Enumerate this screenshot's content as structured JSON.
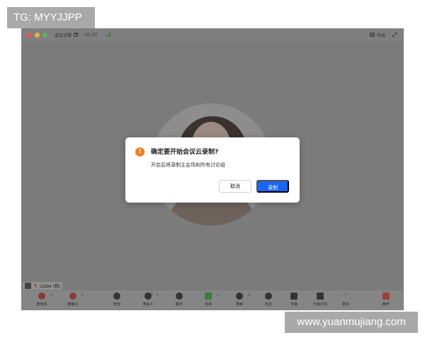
{
  "watermark": {
    "top": "TG: MYYJJPP",
    "bottom": "www.yuanmujiang.com"
  },
  "titlebar": {
    "meeting_info": "会议详情",
    "timer": "01:37",
    "layout_label": "布局",
    "window_controls": [
      "#e8585a",
      "#e8b23a",
      "#55b560"
    ]
  },
  "participant": {
    "name": "Lizzie (我)"
  },
  "toolbar": {
    "items": [
      {
        "id": "mic",
        "label": "麦克风"
      },
      {
        "id": "camera",
        "label": "摄像头"
      },
      {
        "id": "security",
        "label": "安全"
      },
      {
        "id": "participants",
        "label": "参会人",
        "count": "1"
      },
      {
        "id": "chat",
        "label": "聊天"
      },
      {
        "id": "share",
        "label": "共享"
      },
      {
        "id": "record",
        "label": "录制"
      },
      {
        "id": "reaction",
        "label": "反应"
      },
      {
        "id": "caption",
        "label": "字幕"
      },
      {
        "id": "breakout",
        "label": "分组讨论"
      },
      {
        "id": "more",
        "label": "更多"
      },
      {
        "id": "leave",
        "label": "离开"
      }
    ]
  },
  "dialog": {
    "icon": "!",
    "title": "确定要开始会议云录制?",
    "message": "开启后将录制主会场和所有讨论组",
    "cancel_label": "取消",
    "confirm_label": "录制",
    "accent_color": "#1a66f2",
    "warning_color": "#f17f1e"
  }
}
